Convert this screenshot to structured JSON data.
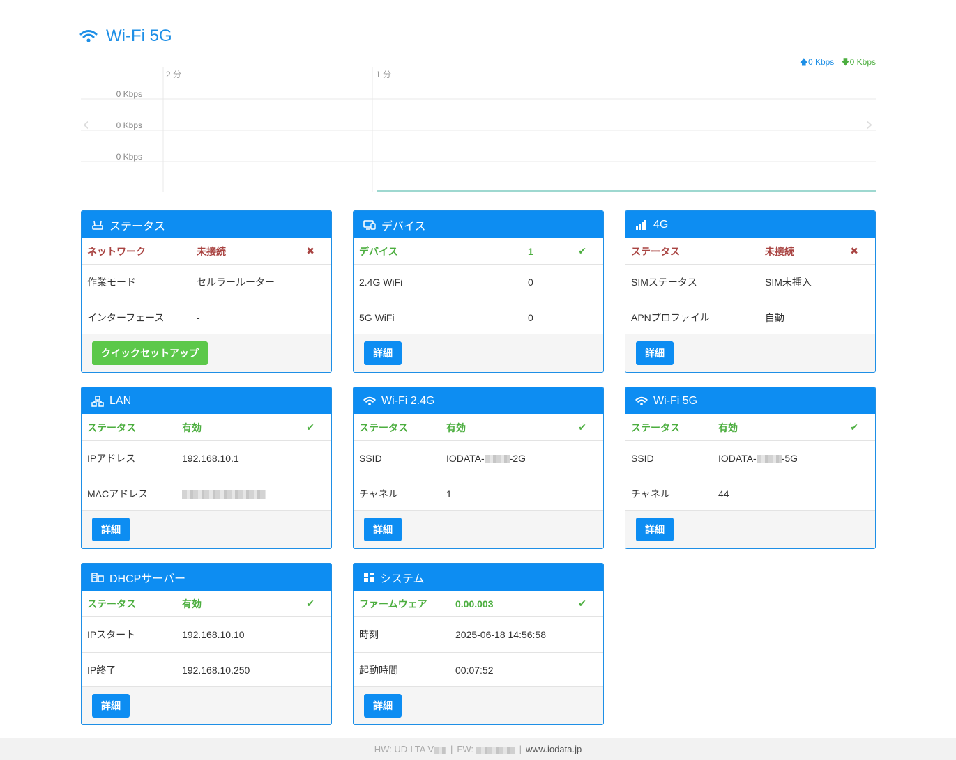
{
  "page": {
    "title": "Wi-Fi 5G"
  },
  "graph": {
    "up_rate": "0 Kbps",
    "down_rate": "0 Kbps",
    "time_labels": [
      "2 分",
      "1 分"
    ],
    "y_labels": [
      "0 Kbps",
      "0 Kbps",
      "0 Kbps"
    ],
    "line_color": "#7ecbc0"
  },
  "panels": {
    "status": {
      "title": "ステータス",
      "rows": [
        {
          "k": "ネットワーク",
          "v": "未接続",
          "state": "ng"
        },
        {
          "k": "作業モード",
          "v": "セルラールーター"
        },
        {
          "k": "インターフェース",
          "v": "-"
        }
      ],
      "button": "クイックセットアップ"
    },
    "device": {
      "title": "デバイス",
      "rows": [
        {
          "k": "デバイス",
          "v": "1",
          "state": "ok"
        },
        {
          "k": "2.4G WiFi",
          "v": "0"
        },
        {
          "k": "5G WiFi",
          "v": "0"
        }
      ],
      "button": "詳細"
    },
    "g4": {
      "title": "4G",
      "rows": [
        {
          "k": "ステータス",
          "v": "未接続",
          "state": "ng"
        },
        {
          "k": "SIMステータス",
          "v": "SIM未挿入"
        },
        {
          "k": "APNプロファイル",
          "v": "自動"
        }
      ],
      "button": "詳細"
    },
    "lan": {
      "title": "LAN",
      "rows": [
        {
          "k": "ステータス",
          "v": "有効",
          "state": "ok"
        },
        {
          "k": "IPアドレス",
          "v": "192.168.10.1"
        },
        {
          "k": "MACアドレス",
          "v": ""
        }
      ],
      "button": "詳細"
    },
    "wifi24": {
      "title": "Wi-Fi 2.4G",
      "rows": [
        {
          "k": "ステータス",
          "v": "有効",
          "state": "ok"
        },
        {
          "k": "SSID",
          "v_prefix": "IODATA-",
          "v_suffix": "-2G"
        },
        {
          "k": "チャネル",
          "v": "1"
        }
      ],
      "button": "詳細"
    },
    "wifi5": {
      "title": "Wi-Fi 5G",
      "rows": [
        {
          "k": "ステータス",
          "v": "有効",
          "state": "ok"
        },
        {
          "k": "SSID",
          "v_prefix": "IODATA-",
          "v_suffix": "-5G"
        },
        {
          "k": "チャネル",
          "v": "44"
        }
      ],
      "button": "詳細"
    },
    "dhcp": {
      "title": "DHCPサーバー",
      "rows": [
        {
          "k": "ステータス",
          "v": "有効",
          "state": "ok"
        },
        {
          "k": "IPスタート",
          "v": "192.168.10.10"
        },
        {
          "k": "IP終了",
          "v": "192.168.10.250"
        }
      ],
      "button": "詳細"
    },
    "system": {
      "title": "システム",
      "rows": [
        {
          "k": "ファームウェア",
          "v": "0.00.003",
          "state": "ok"
        },
        {
          "k": "時刻",
          "v": "2025-06-18 14:56:58"
        },
        {
          "k": "起動時間",
          "v": "00:07:52"
        }
      ],
      "button": "詳細"
    }
  },
  "footer": {
    "hw": "HW: UD-LTA V",
    "fw": "FW:",
    "separator": "|",
    "site": "www.iodata.jp"
  },
  "colors": {
    "accent": "#0d8df2",
    "ok": "#4cae3f",
    "ng": "#a94442",
    "button_green": "#5cc84a"
  }
}
